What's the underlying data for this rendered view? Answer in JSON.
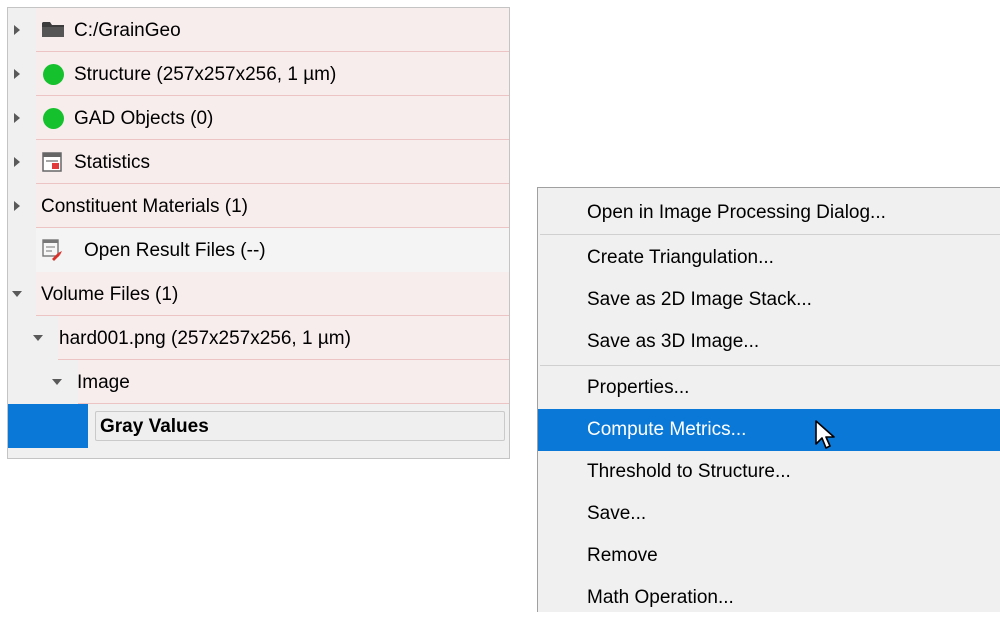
{
  "tree": {
    "items": [
      {
        "label": "C:/GrainGeo",
        "icon": "folder-icon"
      },
      {
        "label": "Structure (257x257x256, 1 µm)",
        "icon": "green-status-dot-icon",
        "color": "#16c12e"
      },
      {
        "label": "GAD Objects (0)",
        "icon": "green-status-dot-icon",
        "color": "#16c12e"
      },
      {
        "label": "Statistics",
        "icon": "statistics-icon"
      },
      {
        "label": "Constituent Materials (1)"
      },
      {
        "label": "Open Result Files (--)",
        "icon": "result-files-icon"
      },
      {
        "label": "Volume Files (1)"
      },
      {
        "label": "hard001.png (257x257x256, 1 µm)"
      },
      {
        "label": "Image"
      },
      {
        "label": "Gray Values",
        "selected": true
      }
    ]
  },
  "context_menu": {
    "items": [
      {
        "label": "Open in Image Processing Dialog..."
      },
      {
        "label": "Create Triangulation..."
      },
      {
        "label": "Save as 2D Image Stack..."
      },
      {
        "label": "Save as 3D Image..."
      },
      {
        "label": "Properties..."
      },
      {
        "label": "Compute Metrics...",
        "highlighted": true
      },
      {
        "label": "Threshold to Structure..."
      },
      {
        "label": "Save..."
      },
      {
        "label": "Remove"
      },
      {
        "label": "Math Operation..."
      }
    ]
  },
  "colors": {
    "selection": "#0a78d7",
    "status_green": "#16c12e",
    "row_tint": "#f8eded"
  }
}
